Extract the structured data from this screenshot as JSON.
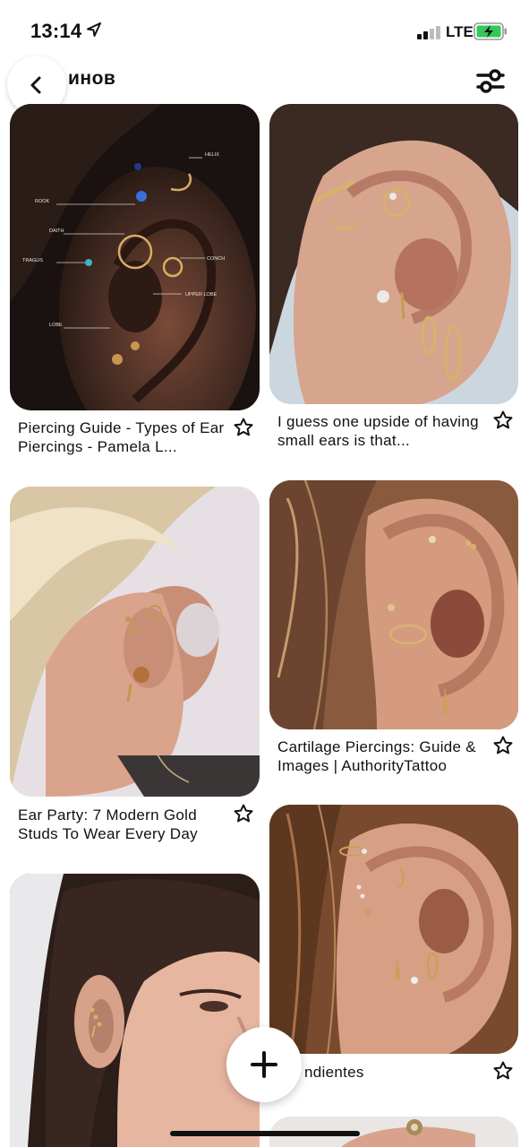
{
  "status_bar": {
    "time": "13:14",
    "network": "LTE"
  },
  "header": {
    "title": "инов"
  },
  "pins": [
    {
      "title": "Piercing Guide - Types of Ear Piercings - Pamela L...",
      "labels": [
        "HELIX",
        "ROOK",
        "DAITH",
        "TRAGUS",
        "CONCH",
        "UPPER LOBE",
        "LOBE"
      ]
    },
    {
      "title": "I guess one upside of having small ears is that..."
    },
    {
      "title": "Ear Party: 7 Modern Gold Studs To Wear Every Day"
    },
    {
      "title": "Cartilage Piercings: Guide & Images | AuthorityTattoo"
    },
    {
      "title": ""
    },
    {
      "title": "ndientes"
    },
    {
      "title": ""
    }
  ],
  "icons": {
    "back": "chevron-left-icon",
    "filter": "sliders-icon",
    "save": "star-outline-icon",
    "add": "plus-icon"
  }
}
